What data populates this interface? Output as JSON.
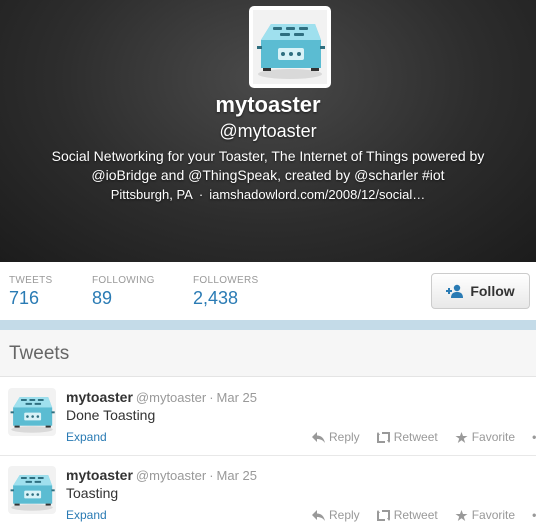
{
  "profile": {
    "name": "mytoaster",
    "handle": "@mytoaster",
    "bio_line1": "Social Networking for your Toaster, The Internet of Things powered by",
    "bio_line2": "@ioBridge and @ThingSpeak, created by @scharler #iot",
    "location": "Pittsburgh, PA",
    "separator": "·",
    "url": "iamshadowlord.com/2008/12/social…"
  },
  "stats": {
    "tweets_label": "TWEETS",
    "tweets_value": "716",
    "following_label": "FOLLOWING",
    "following_value": "89",
    "followers_label": "FOLLOWERS",
    "followers_value": "2,438"
  },
  "follow_button": {
    "label": "Follow"
  },
  "timeline": {
    "heading": "Tweets",
    "tweets": [
      {
        "name": "mytoaster",
        "handle": "@mytoaster",
        "dot": "·",
        "time": "Mar 25",
        "text": "Done Toasting",
        "expand": "Expand",
        "reply": "Reply",
        "retweet": "Retweet",
        "favorite": "Favorite",
        "more": "•••"
      },
      {
        "name": "mytoaster",
        "handle": "@mytoaster",
        "dot": "·",
        "time": "Mar 25",
        "text": "Toasting",
        "expand": "Expand",
        "reply": "Reply",
        "retweet": "Retweet",
        "favorite": "Favorite",
        "more": "•••"
      }
    ]
  },
  "colors": {
    "link": "#2a7bb4",
    "toaster": "#6cc8dc",
    "divider": "#c4dbe8"
  },
  "icons": [
    "toaster-avatar",
    "add-person-icon",
    "reply-icon",
    "retweet-icon",
    "favorite-star-icon",
    "more-icon"
  ]
}
